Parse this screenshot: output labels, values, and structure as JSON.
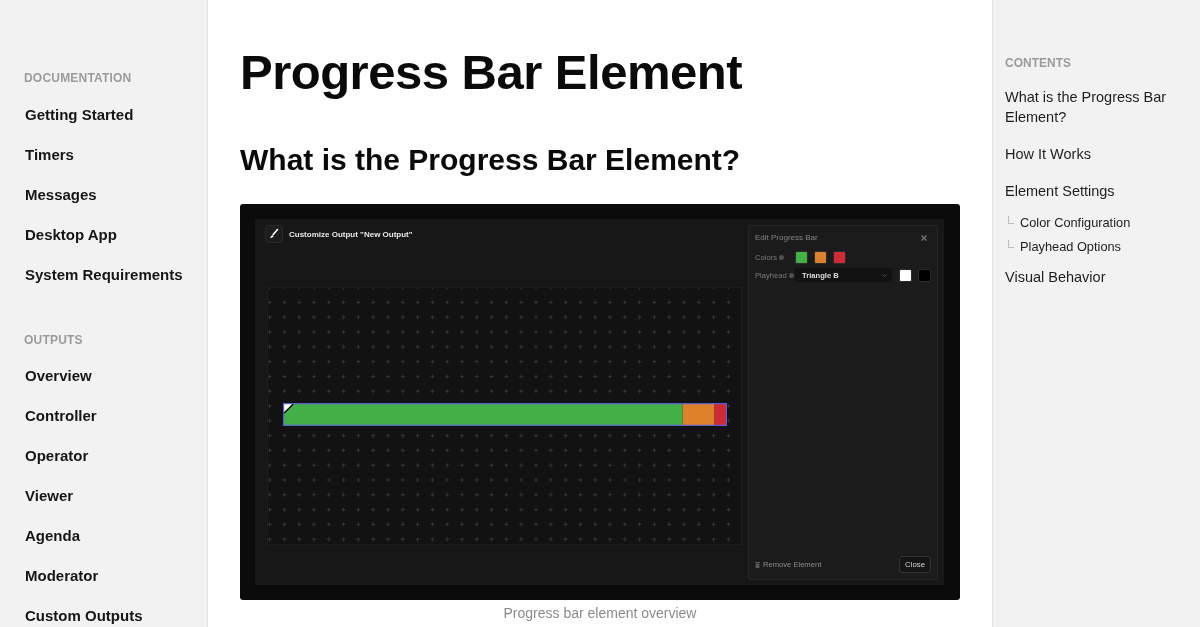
{
  "sidebar": {
    "sections": [
      {
        "title": "DOCUMENTATION",
        "items": [
          "Getting Started",
          "Timers",
          "Messages",
          "Desktop App",
          "System Requirements"
        ]
      },
      {
        "title": "OUTPUTS",
        "items": [
          "Overview",
          "Controller",
          "Operator",
          "Viewer",
          "Agenda",
          "Moderator",
          "Custom Outputs"
        ]
      }
    ]
  },
  "article": {
    "title": "Progress Bar Element",
    "heading": "What is the Progress Bar Element?",
    "figure": {
      "window_title": "Customize Output \"New Output\"",
      "panel": {
        "title": "Edit Progress Bar",
        "rows": [
          {
            "kind": "swatches",
            "label": "Colors",
            "swatches": [
              {
                "color": "#43b047"
              },
              {
                "color": "#dd822a"
              },
              {
                "color": "#cf2a35"
              }
            ]
          },
          {
            "kind": "select",
            "label": "Playhead",
            "value": "Triangle B",
            "swatches": [
              {
                "color": "#ffffff"
              },
              {
                "color": "#000000"
              }
            ]
          }
        ],
        "remove_label": "Remove Element",
        "close_label": "Close"
      },
      "caption": "Progress bar element overview"
    }
  },
  "toc": {
    "title": "CONTENTS",
    "items": [
      {
        "label": "What is the Progress Bar Element?"
      },
      {
        "label": "How It Works"
      },
      {
        "label": "Element Settings",
        "children": [
          {
            "label": "Color Configuration"
          },
          {
            "label": "Playhead Options"
          }
        ]
      },
      {
        "label": "Visual Behavior"
      }
    ]
  }
}
